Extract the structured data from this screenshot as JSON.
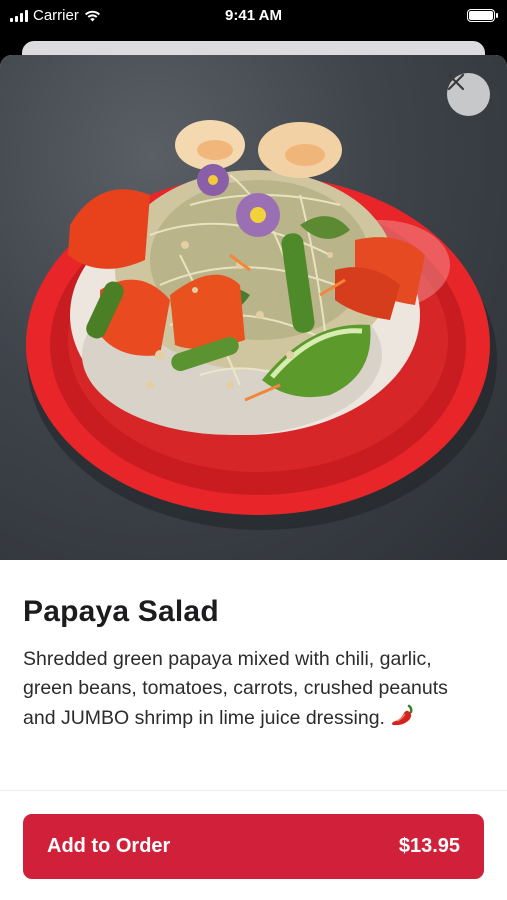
{
  "status_bar": {
    "carrier": "Carrier",
    "time": "9:41 AM"
  },
  "item": {
    "title": "Papaya Salad",
    "description": "Shredded green papaya mixed with chili, garlic, green beans, tomatoes, carrots, crushed peanuts and JUMBO shrimp in lime juice dressing.",
    "description_icon": "chili-pepper-icon"
  },
  "actions": {
    "close_icon": "close-icon",
    "add_label": "Add to Order",
    "price": "$13.95"
  },
  "colors": {
    "accent": "#d0203a",
    "plate_rim": "#e8262a"
  }
}
